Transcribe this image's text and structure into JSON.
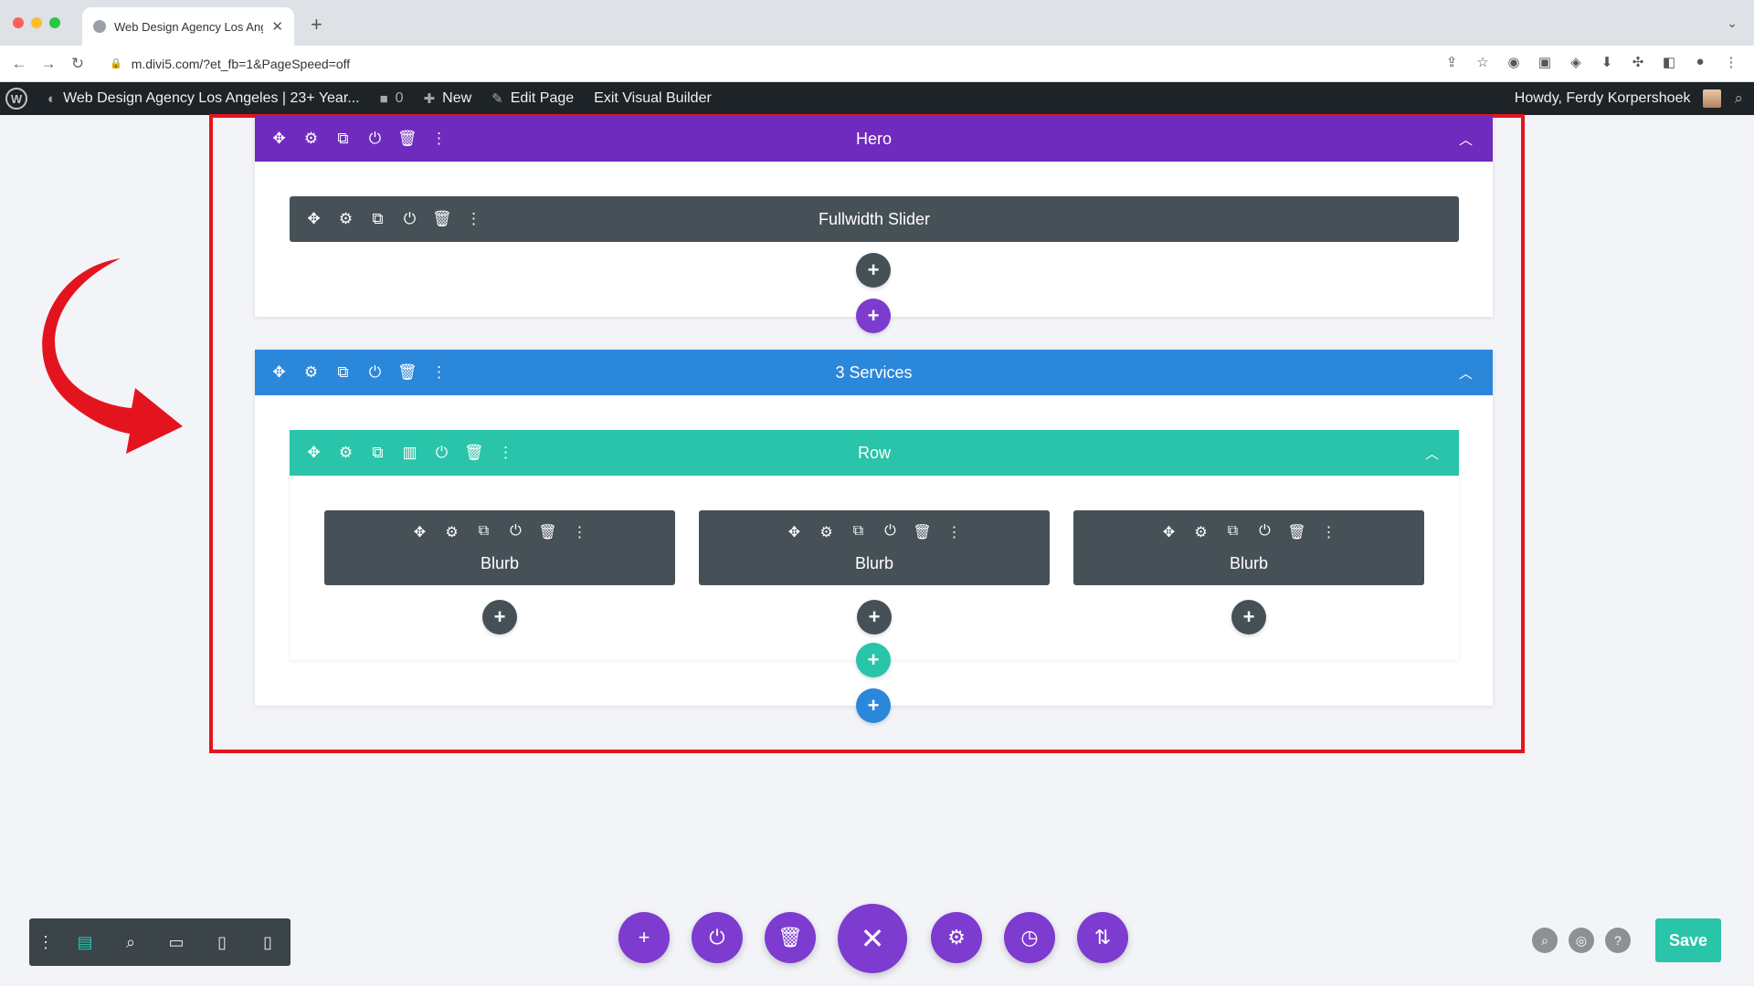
{
  "browser": {
    "tab_title": "Web Design Agency Los Angel",
    "tab_close": "✕",
    "new_tab": "+",
    "tab_menu": "⌄",
    "url": "m.divi5.com/?et_fb=1&PageSpeed=off",
    "traffic_colors": [
      "#ff5f57",
      "#febc2e",
      "#28c840"
    ]
  },
  "wp_admin": {
    "site_name": "Web Design Agency Los Angeles | 23+ Year...",
    "comments_count": "0",
    "new_label": "New",
    "edit_page_label": "Edit Page",
    "exit_label": "Exit Visual Builder",
    "howdy": "Howdy, Ferdy Korpershoek"
  },
  "sections": [
    {
      "label": "Hero",
      "color": "#6f2bbd",
      "module_label": "Fullwidth Slider"
    },
    {
      "label": "3 Services",
      "color": "#2b87da",
      "row_label": "Row",
      "blurbs": [
        "Blurb",
        "Blurb",
        "Blurb"
      ]
    }
  ],
  "builder": {
    "save_label": "Save",
    "accent_purple": "#7d3bcf",
    "accent_teal": "#29c4a9",
    "accent_blue": "#2b87da",
    "highlight_red": "#e4141e"
  }
}
